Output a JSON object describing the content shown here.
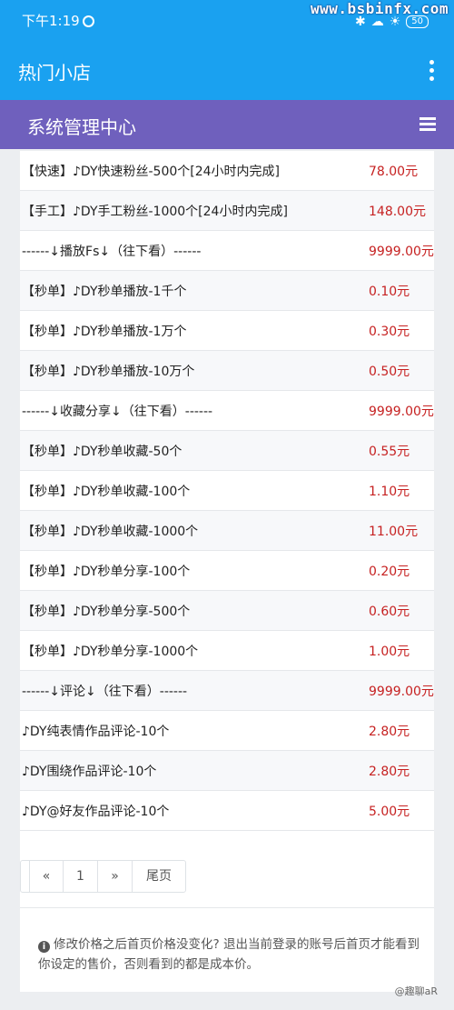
{
  "status": {
    "time": "下午1:19",
    "battery": "50",
    "watermark": "www.bsbinfx.com"
  },
  "app": {
    "title": "热门小店"
  },
  "admin": {
    "title": "系统管理中心"
  },
  "rows": [
    {
      "name": "【快速】♪DY快速粉丝-500个[24小时内完成]",
      "price": "78.00元"
    },
    {
      "name": "【手工】♪DY手工粉丝-1000个[24小时内完成]",
      "price": "148.00元"
    },
    {
      "name": "------↓播放Fs↓（往下看）------",
      "price": "9999.00元"
    },
    {
      "name": "【秒单】♪DY秒单播放-1千个",
      "price": "0.10元"
    },
    {
      "name": "【秒单】♪DY秒单播放-1万个",
      "price": "0.30元"
    },
    {
      "name": "【秒单】♪DY秒单播放-10万个",
      "price": "0.50元"
    },
    {
      "name": "------↓收藏分享↓（往下看）------",
      "price": "9999.00元"
    },
    {
      "name": "【秒单】♪DY秒单收藏-50个",
      "price": "0.55元"
    },
    {
      "name": "【秒单】♪DY秒单收藏-100个",
      "price": "1.10元"
    },
    {
      "name": "【秒单】♪DY秒单收藏-1000个",
      "price": "11.00元"
    },
    {
      "name": "【秒单】♪DY秒单分享-100个",
      "price": "0.20元"
    },
    {
      "name": "【秒单】♪DY秒单分享-500个",
      "price": "0.60元"
    },
    {
      "name": "【秒单】♪DY秒单分享-1000个",
      "price": "1.00元"
    },
    {
      "name": "------↓评论↓（往下看）------",
      "price": "9999.00元"
    },
    {
      "name": "♪DY纯表情作品评论-10个",
      "price": "2.80元"
    },
    {
      "name": "♪DY围绕作品评论-10个",
      "price": "2.80元"
    },
    {
      "name": "♪DY@好友作品评论-10个",
      "price": "5.00元"
    }
  ],
  "pagination": {
    "prev": "«",
    "page": "1",
    "next": "»",
    "last": "尾页"
  },
  "note": {
    "text": "修改价格之后首页价格没变化? 退出当前登录的账号后首页才能看到你设定的售价，否则看到的都是成本价。"
  },
  "footer": {
    "watermark": "@趣聊aR"
  }
}
